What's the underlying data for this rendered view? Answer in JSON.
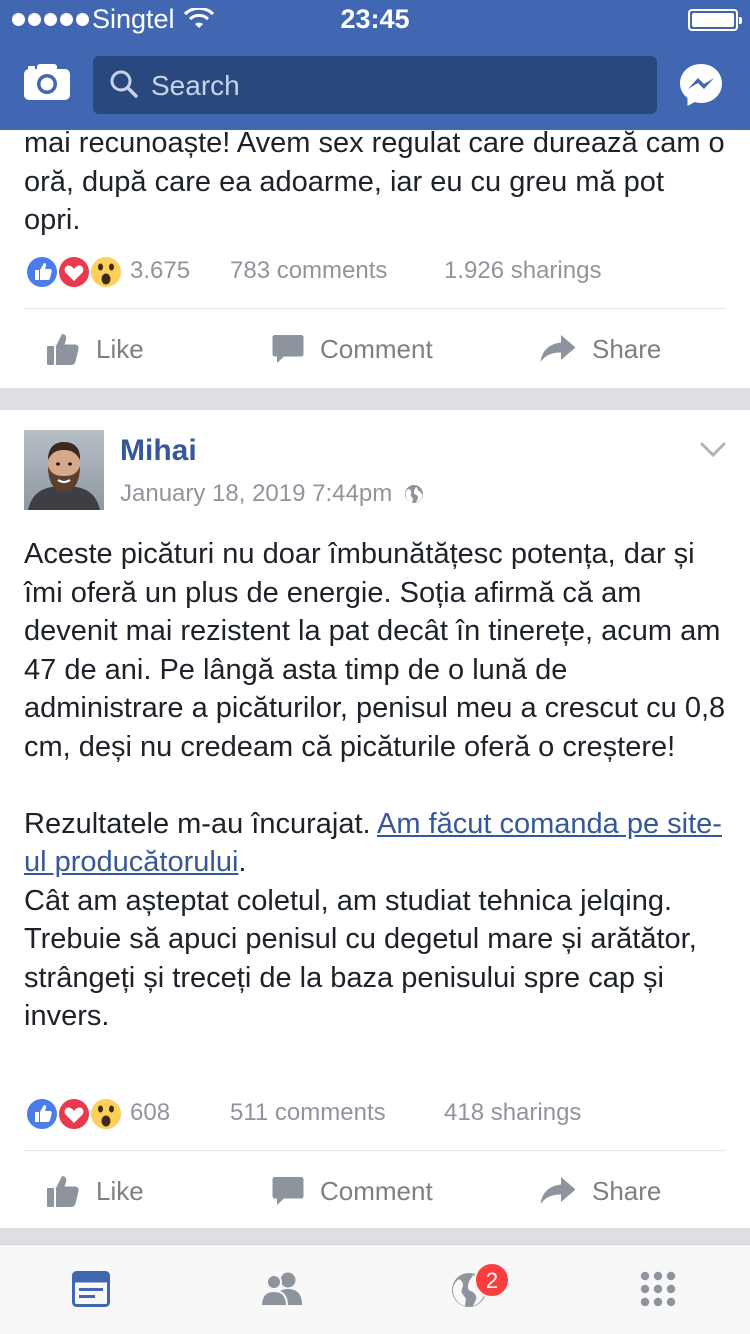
{
  "status_bar": {
    "carrier": "Singtel",
    "time": "23:45"
  },
  "header": {
    "search_placeholder": "Search",
    "left_icon": "camera-icon",
    "right_icon": "messenger-icon",
    "color": "#4267b2"
  },
  "posts": [
    {
      "text": "mai recunoaște! Avem sex regulat care durează cam o oră, după care ea adoarme, iar eu cu greu mă pot opri.",
      "reaction_count": "3.675",
      "comments": "783 comments",
      "shares": "1.926 sharings",
      "actions": {
        "like": "Like",
        "comment": "Comment",
        "share": "Share"
      }
    },
    {
      "author": "Mihai",
      "timestamp": "January 18, 2019 7:44pm",
      "audience_icon": "globe-icon",
      "paragraph1": "Aceste picături nu doar îmbunătățesc potența, dar și îmi oferă un plus de energie. Soția afirmă că am devenit mai rezistent la pat decât în tinerețe, acum am 47 de ani. Pe lângă asta timp de o lună de administrare a picăturilor, penisul meu a crescut cu 0,8 cm, deși nu credeam că picăturile oferă o creștere!",
      "paragraph2_prefix": "Rezultatele m-au încurajat. ",
      "paragraph2_link": "Am făcut comanda pe site-ul producătorului",
      "paragraph2_suffix": ".",
      "paragraph3": "Cât am așteptat coletul, am studiat tehnica jelqing. Trebuie să apuci penisul cu degetul mare și arătător, strângeți și treceți de la baza penisului spre cap și invers.",
      "reaction_count": "608",
      "comments": "511 comments",
      "shares": "418 sharings",
      "actions": {
        "like": "Like",
        "comment": "Comment",
        "share": "Share"
      }
    }
  ],
  "tab_bar": {
    "tabs": [
      "news-feed-icon",
      "friends-icon",
      "notifications-globe-icon",
      "more-menu-icon"
    ],
    "notification_badge": "2",
    "active_color": "#4267b2"
  }
}
